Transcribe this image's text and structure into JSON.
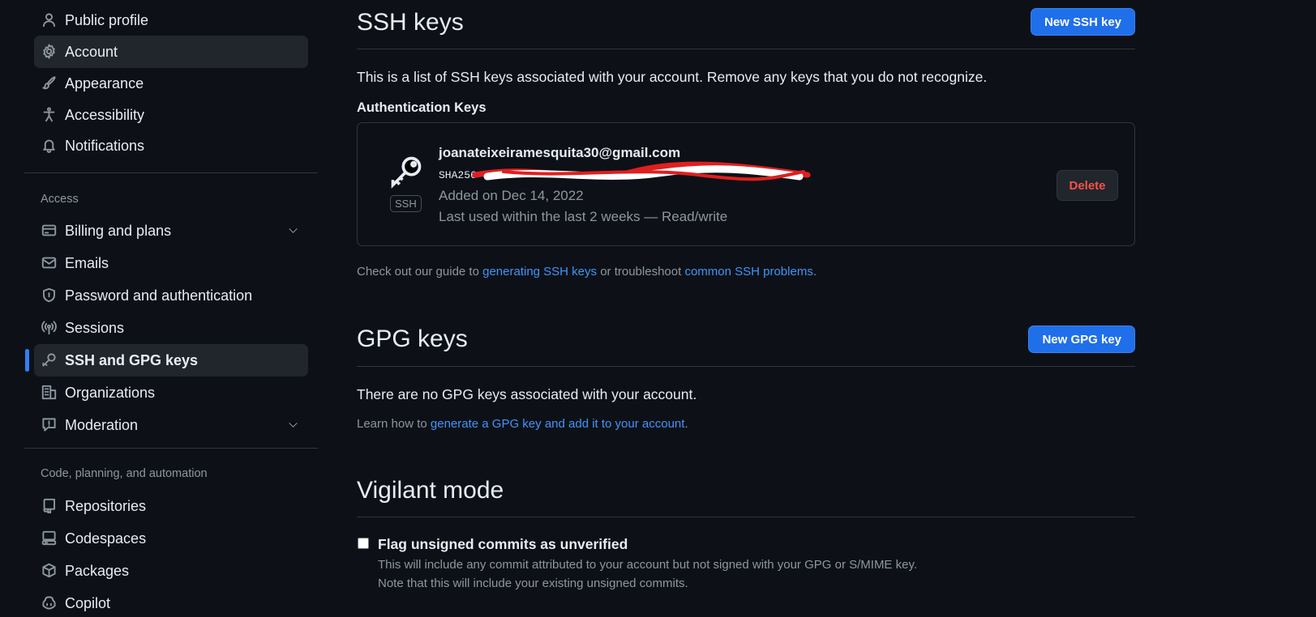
{
  "sidebar": {
    "top_items": [
      {
        "label": "Public profile",
        "icon": "person-icon"
      },
      {
        "label": "Account",
        "icon": "gear-icon"
      },
      {
        "label": "Appearance",
        "icon": "paintbrush-icon"
      },
      {
        "label": "Accessibility",
        "icon": "accessibility-icon"
      },
      {
        "label": "Notifications",
        "icon": "bell-icon"
      }
    ],
    "access_label": "Access",
    "access_items": [
      {
        "label": "Billing and plans",
        "icon": "credit-card-icon"
      },
      {
        "label": "Emails",
        "icon": "mail-icon"
      },
      {
        "label": "Password and authentication",
        "icon": "shield-lock-icon"
      },
      {
        "label": "Sessions",
        "icon": "broadcast-icon"
      },
      {
        "label": "SSH and GPG keys",
        "icon": "key-icon"
      },
      {
        "label": "Organizations",
        "icon": "organization-icon"
      },
      {
        "label": "Moderation",
        "icon": "report-icon"
      }
    ],
    "code_label": "Code, planning, and automation",
    "code_items": [
      {
        "label": "Repositories",
        "icon": "repo-icon"
      },
      {
        "label": "Codespaces",
        "icon": "codespaces-icon"
      },
      {
        "label": "Packages",
        "icon": "package-icon"
      },
      {
        "label": "Copilot",
        "icon": "copilot-icon"
      }
    ]
  },
  "ssh": {
    "title": "SSH keys",
    "new_button": "New SSH key",
    "description": "This is a list of SSH keys associated with your account. Remove any keys that you do not recognize.",
    "auth_heading": "Authentication Keys",
    "key": {
      "title": "joanateixeiramesquita30@gmail.com",
      "fingerprint_prefix": "SHA256",
      "badge": "SSH",
      "added": "Added on Dec 14, 2022",
      "last_used": "Last used within the last 2 weeks — Read/write",
      "delete_label": "Delete"
    },
    "guide_prefix": "Check out our guide to ",
    "guide_link1": "generating SSH keys",
    "guide_middle": " or troubleshoot ",
    "guide_link2": "common SSH problems",
    "guide_suffix": "."
  },
  "gpg": {
    "title": "GPG keys",
    "new_button": "New GPG key",
    "empty_text": "There are no GPG keys associated with your account.",
    "learn_prefix": "Learn how to ",
    "learn_link": "generate a GPG key and add it to your account",
    "learn_suffix": "."
  },
  "vigilant": {
    "title": "Vigilant mode",
    "checkbox_label": "Flag unsigned commits as unverified",
    "checked": false,
    "desc1": "This will include any commit attributed to your account but not signed with your GPG or S/MIME key.",
    "desc2": "Note that this will include your existing unsigned commits."
  },
  "colors": {
    "background": "#0d1117",
    "accent": "#1f6feb",
    "link": "#4493f8",
    "danger": "#f85149",
    "redaction": "#e01f1f"
  }
}
